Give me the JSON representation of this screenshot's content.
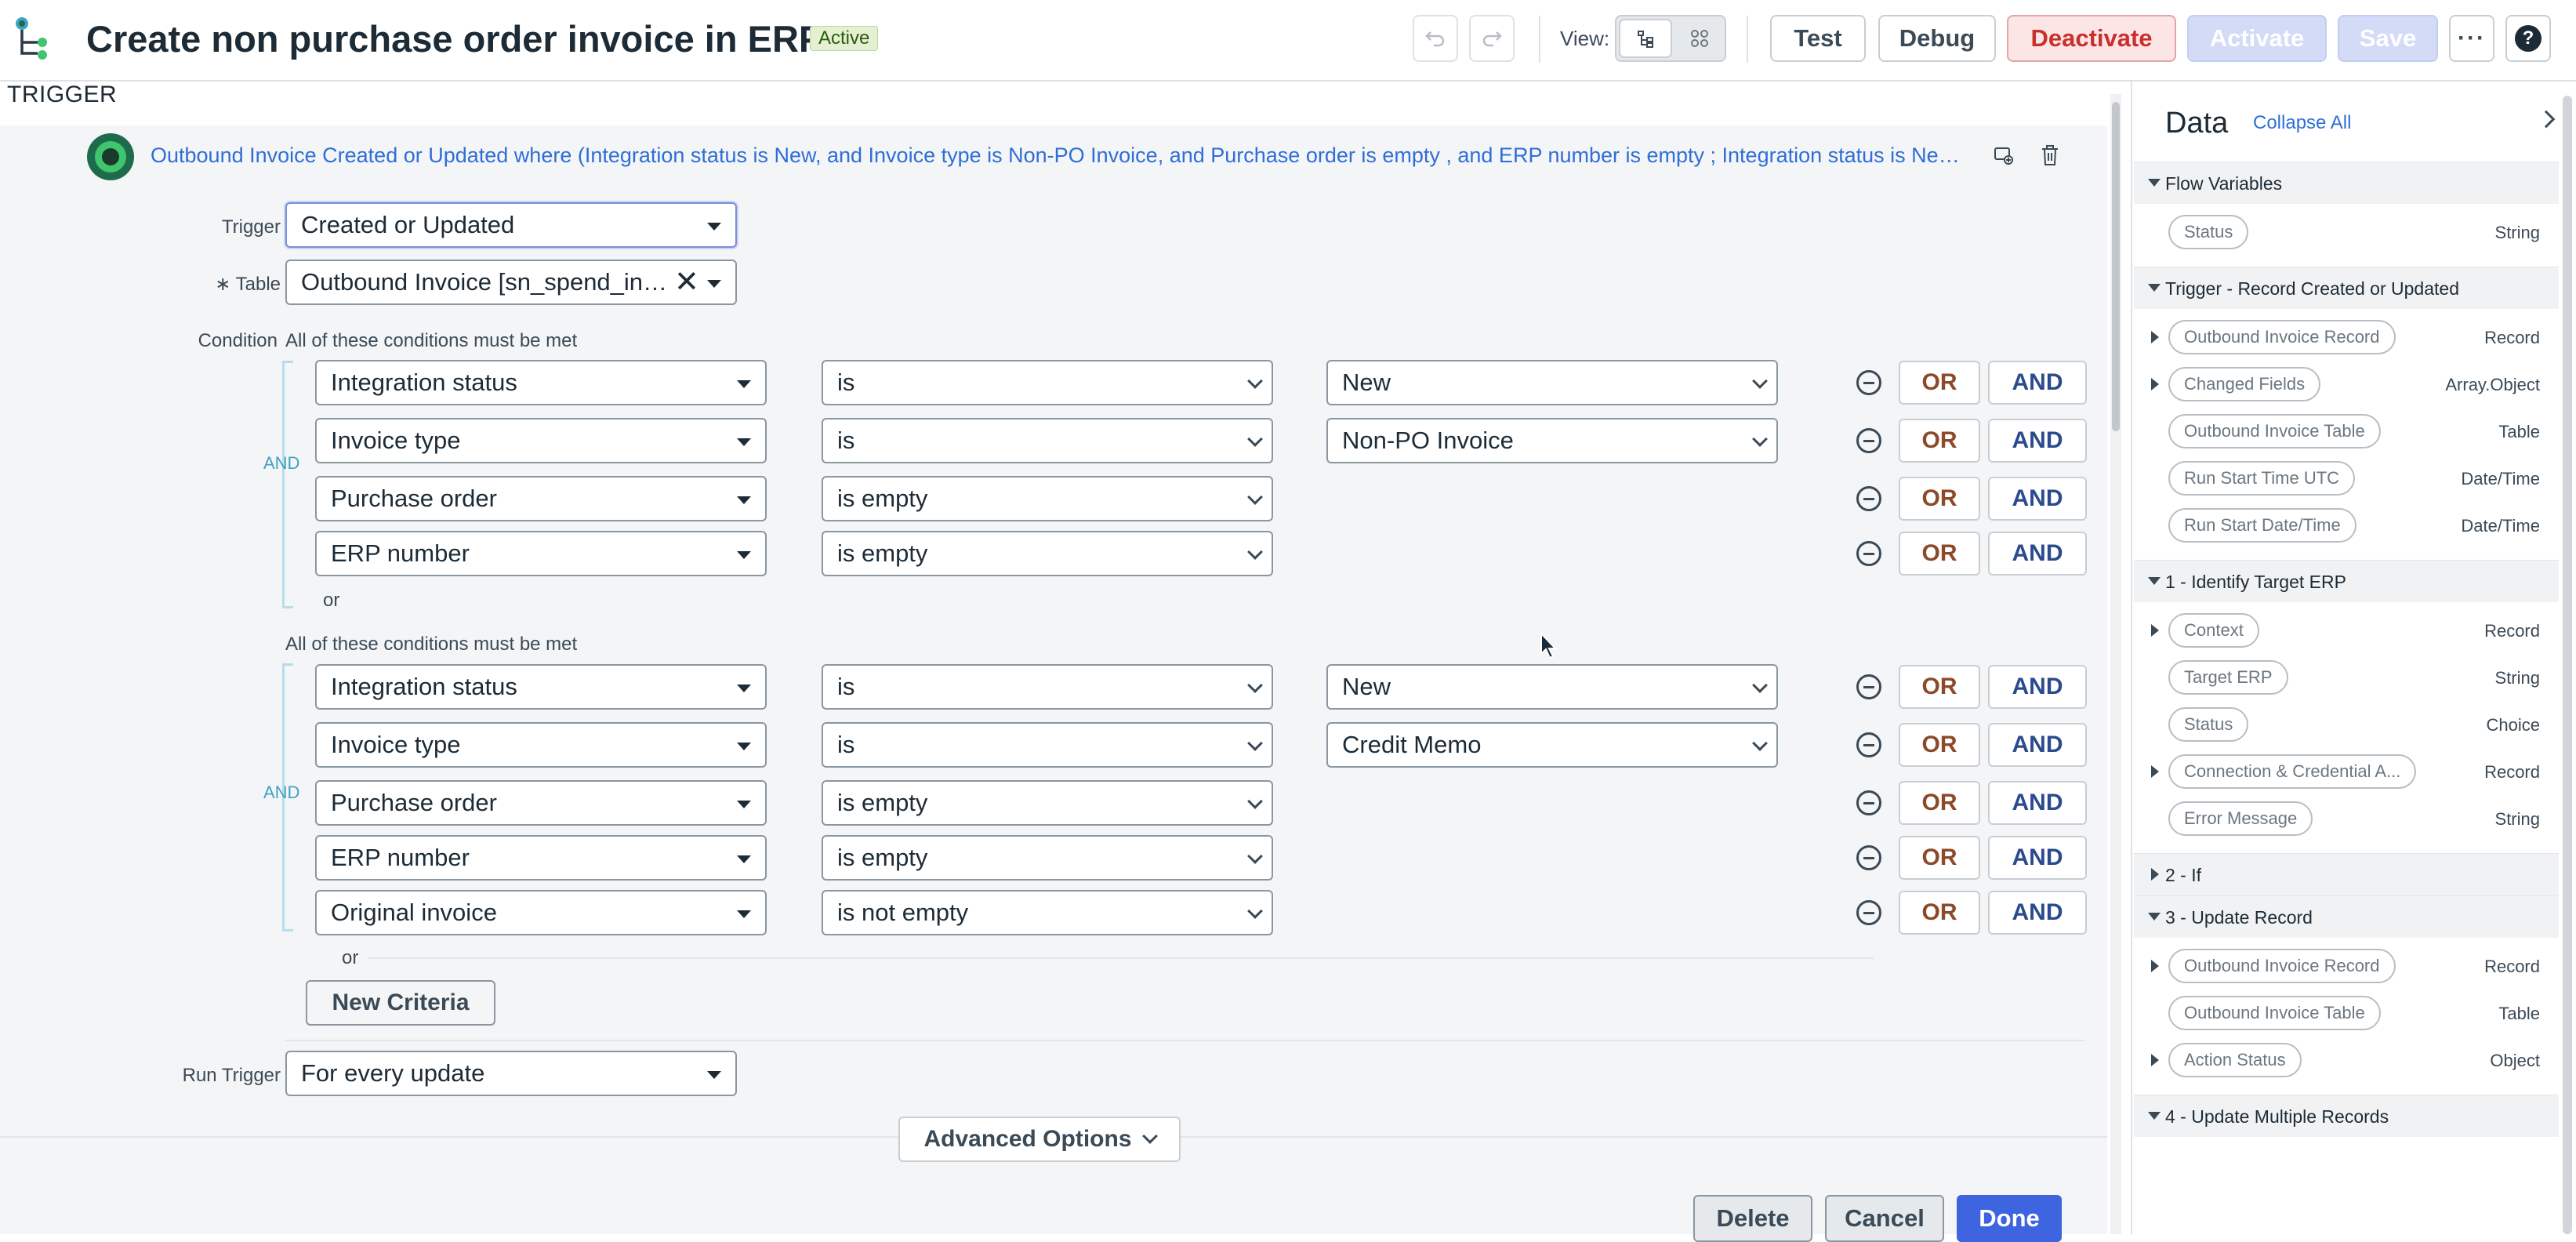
{
  "header": {
    "title": "Create non purchase order invoice in ERP",
    "status_badge": "Active",
    "view_label": "View:",
    "buttons": {
      "test": "Test",
      "debug": "Debug",
      "deactivate": "Deactivate",
      "activate": "Activate",
      "save": "Save"
    }
  },
  "trigger": {
    "heading": "TRIGGER",
    "summary": "Outbound Invoice Created or Updated where (Integration status is New, and Invoice type is Non-PO Invoice, and Purchase order is empty , and ERP number is empty ; Integration status is New, and Invoice type is Credit Memo, and Purchase order is empty , and ERP number is empty , and Original invoice is not empty)",
    "trigger_label": "Trigger",
    "trigger_value": "Created or Updated",
    "table_label": "Table",
    "table_required_mark": "∗",
    "table_value": "Outbound Invoice [sn_spend_intg_outbound_invoice]",
    "condition_label": "Condition",
    "conditions_must_be_met": "All of these conditions must be met",
    "and_label": "AND",
    "or_label": "or",
    "or_button": "OR",
    "and_button": "AND",
    "group1": [
      {
        "field": "Integration status",
        "operator": "is",
        "value": "New"
      },
      {
        "field": "Invoice type",
        "operator": "is",
        "value": "Non-PO Invoice"
      },
      {
        "field": "Purchase order",
        "operator": "is empty",
        "value": ""
      },
      {
        "field": "ERP number",
        "operator": "is empty",
        "value": ""
      }
    ],
    "group2": [
      {
        "field": "Integration status",
        "operator": "is",
        "value": "New"
      },
      {
        "field": "Invoice type",
        "operator": "is",
        "value": "Credit Memo"
      },
      {
        "field": "Purchase order",
        "operator": "is empty",
        "value": ""
      },
      {
        "field": "ERP number",
        "operator": "is empty",
        "value": ""
      },
      {
        "field": "Original invoice",
        "operator": "is not empty",
        "value": ""
      }
    ],
    "new_criteria": "New Criteria",
    "run_trigger_label": "Run Trigger",
    "run_trigger_value": "For every update",
    "advanced_options": "Advanced Options"
  },
  "footer": {
    "delete": "Delete",
    "cancel": "Cancel",
    "done": "Done"
  },
  "panel": {
    "title": "Data",
    "collapse_all": "Collapse All",
    "sections": [
      {
        "label": "Flow Variables",
        "items": [
          {
            "name": "Status",
            "type": "String",
            "expandable": false
          }
        ]
      },
      {
        "label": "Trigger - Record Created or Updated",
        "items": [
          {
            "name": "Outbound Invoice Record",
            "type": "Record",
            "expandable": true
          },
          {
            "name": "Changed Fields",
            "type": "Array.Object",
            "expandable": true
          },
          {
            "name": "Outbound Invoice Table",
            "type": "Table",
            "expandable": false
          },
          {
            "name": "Run Start Time UTC",
            "type": "Date/Time",
            "expandable": false
          },
          {
            "name": "Run Start Date/Time",
            "type": "Date/Time",
            "expandable": false
          }
        ]
      },
      {
        "label": "1 - Identify Target ERP",
        "items": [
          {
            "name": "Context",
            "type": "Record",
            "expandable": true
          },
          {
            "name": "Target ERP",
            "type": "String",
            "expandable": false
          },
          {
            "name": "Status",
            "type": "Choice",
            "expandable": false
          },
          {
            "name": "Connection & Credential A...",
            "type": "Record",
            "expandable": true
          },
          {
            "name": "Error Message",
            "type": "String",
            "expandable": false
          }
        ]
      },
      {
        "label": "2 - If",
        "items": []
      },
      {
        "label": "3 - Update Record",
        "items": [
          {
            "name": "Outbound Invoice Record",
            "type": "Record",
            "expandable": true
          },
          {
            "name": "Outbound Invoice Table",
            "type": "Table",
            "expandable": false
          },
          {
            "name": "Action Status",
            "type": "Object",
            "expandable": true
          }
        ]
      },
      {
        "label": "4 - Update Multiple Records",
        "items": []
      }
    ]
  }
}
